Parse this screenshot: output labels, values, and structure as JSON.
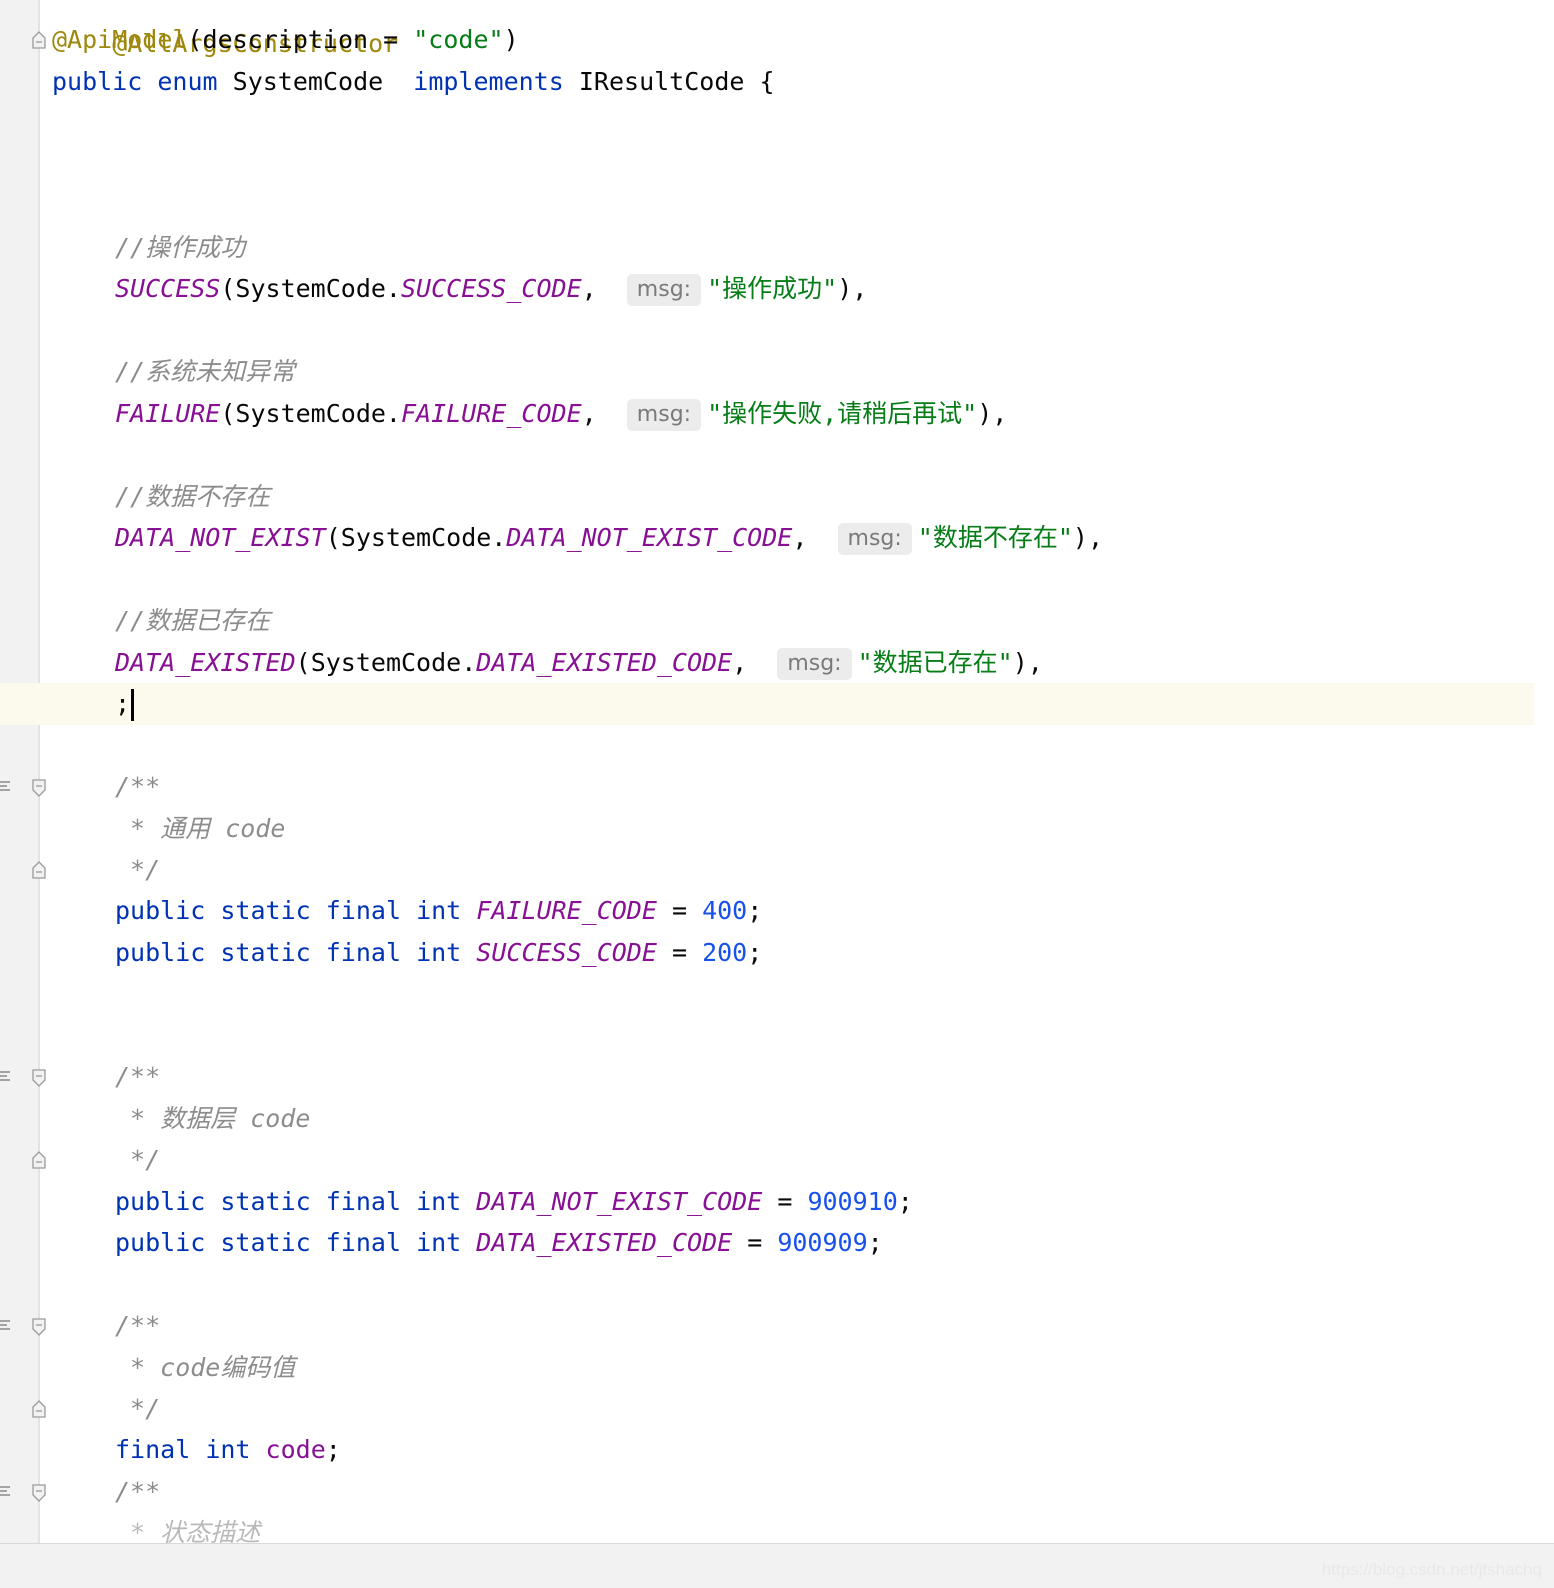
{
  "editor": {
    "file_language": "java",
    "tokens": {
      "annotation_allargs": "@AllArgsConstructor",
      "annotation_apimodel": "@ApiModel",
      "apimodel_args_open": "(description = ",
      "apimodel_value": "\"code\"",
      "close_paren": ")",
      "kw_public": "public",
      "kw_enum": "enum",
      "kw_implements": "implements",
      "kw_static": "static",
      "kw_final": "final",
      "kw_int": "int",
      "enum_name": "SystemCode",
      "interface_name": "IResultCode",
      "open_brace": "{",
      "hint_label": "msg:",
      "systemcode_dot": "SystemCode.",
      "args_sep": ", ",
      "close_call": "),",
      "semicolon": ";",
      "equals": " = ",
      "doc_open": "/**",
      "doc_close": " */",
      "field_code": "code"
    },
    "constants": [
      {
        "comment": "//操作成功",
        "name": "SUCCESS",
        "code_ref": "SUCCESS_CODE",
        "msg": "\"操作成功\""
      },
      {
        "comment": "//系统未知异常",
        "name": "FAILURE",
        "code_ref": "FAILURE_CODE",
        "msg": "\"操作失败,请稍后再试\""
      },
      {
        "comment": "//数据不存在",
        "name": "DATA_NOT_EXIST",
        "code_ref": "DATA_NOT_EXIST_CODE",
        "msg": "\"数据不存在\""
      },
      {
        "comment": "//数据已存在",
        "name": "DATA_EXISTED",
        "code_ref": "DATA_EXISTED_CODE",
        "msg": "\"数据已存在\""
      }
    ],
    "doc_comments": [
      {
        "text": " * 通用 code"
      },
      {
        "text": " * 数据层 code"
      },
      {
        "text": " * code编码值"
      }
    ],
    "fields": [
      {
        "name": "FAILURE_CODE",
        "value": "400"
      },
      {
        "name": "SUCCESS_CODE",
        "value": "200"
      },
      {
        "name": "DATA_NOT_EXIST_CODE",
        "value": "900910"
      },
      {
        "name": "DATA_EXISTED_CODE",
        "value": "900909"
      }
    ],
    "partial_doc_text": " * 状态描述"
  },
  "watermark": "https://blog.csdn.net/jtshachq",
  "colors": {
    "keyword": "#0033b3",
    "annotation": "#9e880d",
    "string": "#067d17",
    "constant": "#871094",
    "number": "#1750eb",
    "comment": "#8c8c8c",
    "current_line": "#fcfaed",
    "gutter": "#f2f2f2"
  }
}
